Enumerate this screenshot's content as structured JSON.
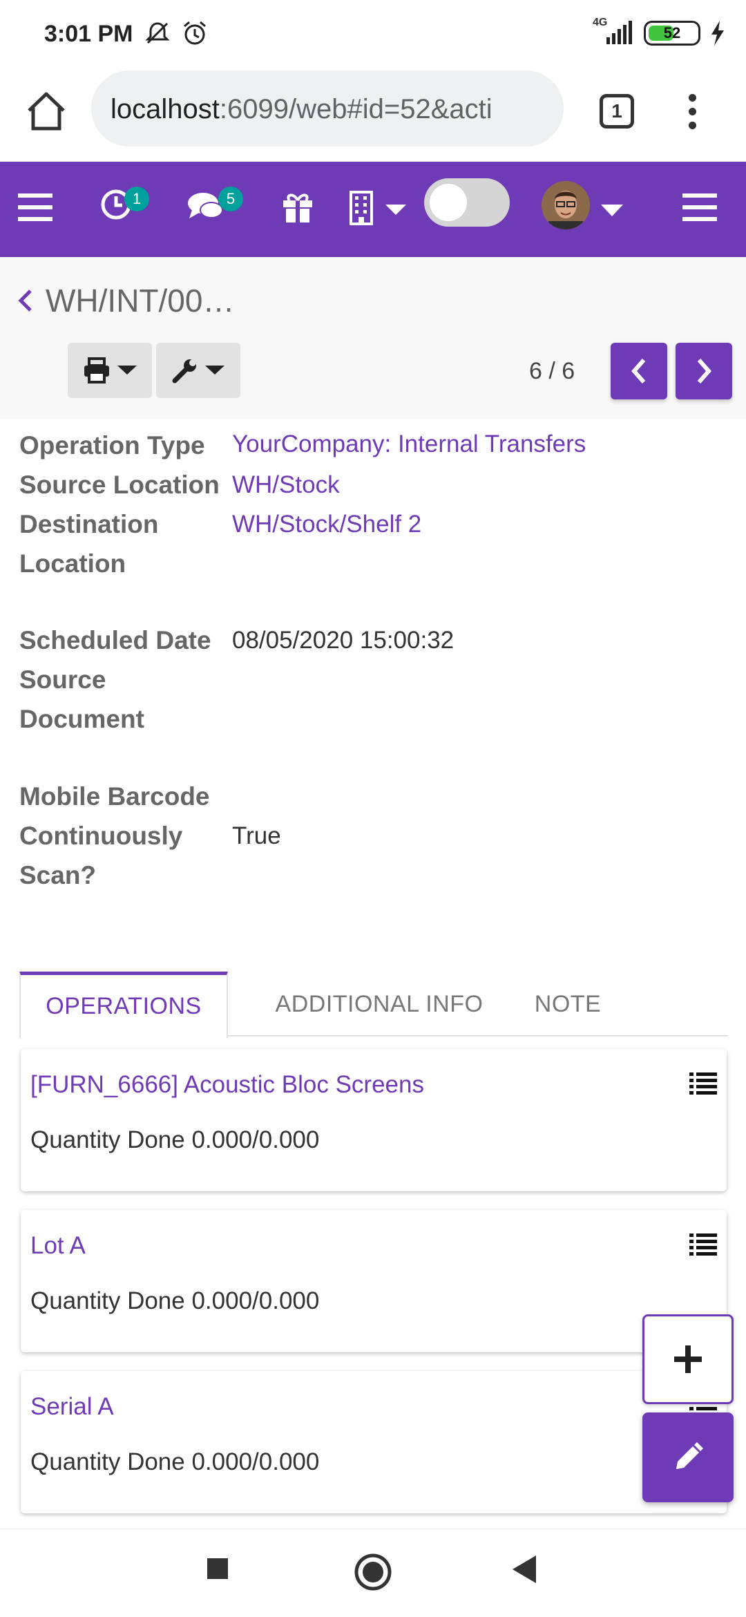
{
  "status_bar": {
    "time": "3:01 PM",
    "network": "4G",
    "battery": "52",
    "battery_level": 0.52,
    "icons": [
      "mute-icon",
      "alarm-icon",
      "signal-icon",
      "battery-icon",
      "charging-icon"
    ]
  },
  "browser": {
    "url_host": "localhost",
    "url_rest": ":6099/web#id=52&acti",
    "tab_count": "1",
    "icons": [
      "home-icon",
      "tabs-icon",
      "more-icon"
    ]
  },
  "navbar": {
    "activity_count": "1",
    "message_count": "5",
    "icons": [
      "menu-icon",
      "clock-icon",
      "chat-icon",
      "gift-icon",
      "building-icon",
      "toggle",
      "avatar",
      "hamburger-icon"
    ],
    "accent": "#6f3ab6",
    "badge_color": "#00a09d"
  },
  "control_panel": {
    "breadcrumb_title": "WH/INT/00…",
    "pager": "6 / 6",
    "icons": [
      "print-icon",
      "wrench-icon",
      "chevron-left-icon",
      "chevron-right-icon"
    ]
  },
  "form": {
    "operation_type_label": "Operation Type",
    "operation_type_value": "YourCompany: Internal Transfers",
    "source_location_label": "Source Location",
    "source_location_value": "WH/Stock",
    "destination_location_label_1": "Destination",
    "destination_location_label_2": "Location",
    "destination_location_value": "WH/Stock/Shelf 2",
    "scheduled_date_label": "Scheduled Date",
    "scheduled_date_value": "08/05/2020 15:00:32",
    "source_document_label_1": "Source",
    "source_document_label_2": "Document",
    "barcode_label_1": "Mobile Barcode",
    "barcode_label_2": "Continuously",
    "barcode_label_3": "Scan?",
    "barcode_value": "True"
  },
  "tabs": [
    {
      "label": "OPERATIONS",
      "active": true
    },
    {
      "label": "ADDITIONAL INFO",
      "active": false
    },
    {
      "label": "NOTE",
      "active": false
    }
  ],
  "operations": [
    {
      "title": "[FURN_6666] Acoustic Bloc Screens",
      "quantity": "Quantity Done 0.000/0.000"
    },
    {
      "title": "Lot A",
      "quantity": "Quantity Done 0.000/0.000"
    },
    {
      "title": "Serial A",
      "quantity": "Quantity Done 0.000/0.000"
    }
  ],
  "fab": {
    "icons": [
      "plus-icon",
      "pencil-icon"
    ]
  },
  "android_nav": {
    "icons": [
      "recents-icon",
      "home-circle-icon",
      "back-icon"
    ]
  }
}
